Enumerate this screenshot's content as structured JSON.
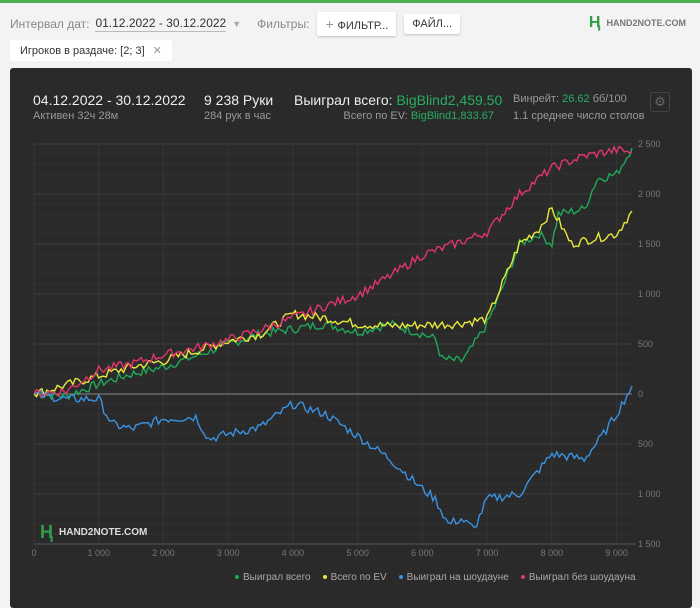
{
  "header": {
    "date_label": "Интервал дат:",
    "date_value": "01.12.2022 - 30.12.2022",
    "filters_label": "Фильтры:",
    "filter_button": "ФИЛЬТР...",
    "file_button": "ФАЙЛ...",
    "logo": "HAND2NOTE.COM"
  },
  "chip": {
    "label": "Игроков в раздаче: [2; 3]"
  },
  "stats": {
    "period": "04.12.2022 - 30.12.2022",
    "active": "Активен 32ч 28м",
    "hands": "9 238 Руки",
    "hands_per_hour": "284 рук в час",
    "won_label": "Выиграл всего:",
    "won_value": "BigBlind2,459.50",
    "ev_label": "Всего по EV:",
    "ev_value": "BigBlind1,833.67",
    "winrate_label": "Винрейт:",
    "winrate_value": "26.62",
    "winrate_unit": "бб/100",
    "tables": "1.1 среднее число столов"
  },
  "watermark": "HAND2NOTE.COM",
  "chart_data": {
    "type": "line",
    "xlabel": "",
    "ylabel": "",
    "xlim": [
      0,
      9238
    ],
    "ylim": [
      -1500,
      2500
    ],
    "grid": true,
    "legend_position": "bottom-right",
    "x_ticks": [
      0,
      1000,
      2000,
      3000,
      4000,
      5000,
      6000,
      7000,
      8000,
      9000
    ],
    "x_tick_labels": [
      "0",
      "1 000",
      "2 000",
      "3 000",
      "4 000",
      "5 000",
      "6 000",
      "7 000",
      "8 000",
      "9 000"
    ],
    "y_ticks": [
      2500,
      2000,
      1500,
      1000,
      500,
      0,
      -500,
      -1000,
      -1500
    ],
    "y_tick_labels": [
      "2 500",
      "2 000",
      "1 500",
      "1 000",
      "500",
      "0",
      "500",
      "1 000",
      "1 500"
    ],
    "series": [
      {
        "name": "Выиграл всего",
        "color": "#1fa85a",
        "points": [
          [
            0,
            0
          ],
          [
            500,
            -20
          ],
          [
            1000,
            100
          ],
          [
            1500,
            200
          ],
          [
            2000,
            270
          ],
          [
            2500,
            380
          ],
          [
            3000,
            500
          ],
          [
            3500,
            600
          ],
          [
            4000,
            650
          ],
          [
            4500,
            700
          ],
          [
            5000,
            620
          ],
          [
            5500,
            700
          ],
          [
            6000,
            600
          ],
          [
            6200,
            550
          ],
          [
            6300,
            350
          ],
          [
            6600,
            330
          ],
          [
            6700,
            400
          ],
          [
            7000,
            700
          ],
          [
            7200,
            1000
          ],
          [
            7500,
            1500
          ],
          [
            7800,
            1600
          ],
          [
            8000,
            1500
          ],
          [
            8100,
            1800
          ],
          [
            8500,
            1850
          ],
          [
            8700,
            2150
          ],
          [
            9000,
            2200
          ],
          [
            9238,
            2460
          ]
        ]
      },
      {
        "name": "Всего по EV",
        "color": "#e8e83a",
        "points": [
          [
            0,
            0
          ],
          [
            1000,
            180
          ],
          [
            1500,
            270
          ],
          [
            2000,
            330
          ],
          [
            2500,
            430
          ],
          [
            3000,
            530
          ],
          [
            3500,
            600
          ],
          [
            4000,
            800
          ],
          [
            4500,
            760
          ],
          [
            5000,
            700
          ],
          [
            5500,
            680
          ],
          [
            6000,
            690
          ],
          [
            6500,
            700
          ],
          [
            7000,
            750
          ],
          [
            7200,
            1050
          ],
          [
            7500,
            1500
          ],
          [
            7800,
            1650
          ],
          [
            8000,
            1850
          ],
          [
            8300,
            1500
          ],
          [
            8600,
            1550
          ],
          [
            9000,
            1600
          ],
          [
            9238,
            1830
          ]
        ]
      },
      {
        "name": "Выиграл на шоудауне",
        "color": "#3a92e0",
        "points": [
          [
            0,
            0
          ],
          [
            500,
            -50
          ],
          [
            1000,
            -50
          ],
          [
            1200,
            -300
          ],
          [
            1500,
            -350
          ],
          [
            2000,
            -250
          ],
          [
            2500,
            -230
          ],
          [
            2700,
            -450
          ],
          [
            3000,
            -400
          ],
          [
            3500,
            -330
          ],
          [
            4000,
            -100
          ],
          [
            4500,
            -200
          ],
          [
            5000,
            -420
          ],
          [
            5500,
            -650
          ],
          [
            6000,
            -950
          ],
          [
            6200,
            -1050
          ],
          [
            6400,
            -1300
          ],
          [
            6600,
            -1250
          ],
          [
            6800,
            -1350
          ],
          [
            7000,
            -1050
          ],
          [
            7500,
            -1000
          ],
          [
            8000,
            -600
          ],
          [
            8500,
            -650
          ],
          [
            8800,
            -400
          ],
          [
            9000,
            -200
          ],
          [
            9238,
            80
          ]
        ]
      },
      {
        "name": "Выиграл без шоудауна",
        "color": "#e0366a",
        "points": [
          [
            0,
            0
          ],
          [
            500,
            30
          ],
          [
            1000,
            240
          ],
          [
            1500,
            300
          ],
          [
            2000,
            390
          ],
          [
            2500,
            460
          ],
          [
            3000,
            540
          ],
          [
            3500,
            640
          ],
          [
            4000,
            760
          ],
          [
            4500,
            880
          ],
          [
            5000,
            990
          ],
          [
            5500,
            1180
          ],
          [
            6000,
            1390
          ],
          [
            6500,
            1500
          ],
          [
            7000,
            1620
          ],
          [
            7500,
            2000
          ],
          [
            8000,
            2260
          ],
          [
            8500,
            2380
          ],
          [
            9000,
            2440
          ],
          [
            9238,
            2420
          ]
        ]
      }
    ]
  }
}
